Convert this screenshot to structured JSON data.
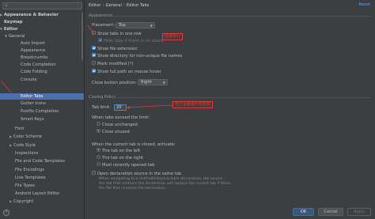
{
  "search": {
    "placeholder": ""
  },
  "sidebar": {
    "items": [
      {
        "label": "Appearance & Behavior"
      },
      {
        "label": "Keymap"
      },
      {
        "label": "Editor"
      },
      {
        "label": "General"
      },
      {
        "label": "Auto Import"
      },
      {
        "label": "Appearance"
      },
      {
        "label": "Breadcrumbs"
      },
      {
        "label": "Code Completion"
      },
      {
        "label": "Code Folding"
      },
      {
        "label": "Console"
      },
      {
        "label": "Editor Tabs"
      },
      {
        "label": "Gutter Icons"
      },
      {
        "label": "Postfix Completion"
      },
      {
        "label": "Smart Keys"
      },
      {
        "label": "Font"
      },
      {
        "label": "Color Scheme"
      },
      {
        "label": "Code Style"
      },
      {
        "label": "Inspections"
      },
      {
        "label": "File and Code Templates"
      },
      {
        "label": "File Encodings"
      },
      {
        "label": "Live Templates"
      },
      {
        "label": "File Types"
      },
      {
        "label": "Android Layout Editor"
      },
      {
        "label": "Copyright"
      }
    ]
  },
  "breadcrumb": {
    "part1": "Editor",
    "part2": "General",
    "part3": "Editor Tabs",
    "sep": "›"
  },
  "reset_label": "Reset",
  "appearance": {
    "title": "Appearance",
    "placement_label": "Placement:",
    "placement_value": "Top",
    "show_tabs_one_row": "Show tabs in one row",
    "hide_tabs_no_space": "Hide tabs if there is no space",
    "show_file_extension": "Show file extension",
    "show_directory": "Show directory for non-unique file names",
    "mark_modified": "Mark modified (*)",
    "show_full_path": "Show full path on mouse hover",
    "close_button_label": "Close button position:",
    "close_button_value": "Right"
  },
  "closing": {
    "title": "Closing Policy",
    "tab_limit_label": "Tab limit:",
    "tab_limit_value": "20",
    "when_exceeds": "When tabs exceed the limit:",
    "close_unchanged": "Close unchanged",
    "close_unused": "Close unused",
    "when_closed": "When the current tab is closed, activate:",
    "tab_left": "The tab on the left",
    "tab_right": "The tab on the right",
    "most_recent": "Most recently opened tab",
    "open_decl": "Open declaration source in the same tab",
    "note_line1": "When navigating to a method/class/variable declaration, the source",
    "note_line2": "the tab that contains the declaration will replace the current tab if there",
    "note_line3": "the file that contains the declaration."
  },
  "annotations": {
    "one_row": "取消单行",
    "limit": "自己设置最大标签数"
  },
  "buttons": {
    "ok": "OK",
    "cancel": "Cancel",
    "apply": "Apply"
  },
  "help": "?",
  "colors": {
    "selection": "#4b6eaf",
    "annotation": "#e53935",
    "link": "#589df6"
  }
}
